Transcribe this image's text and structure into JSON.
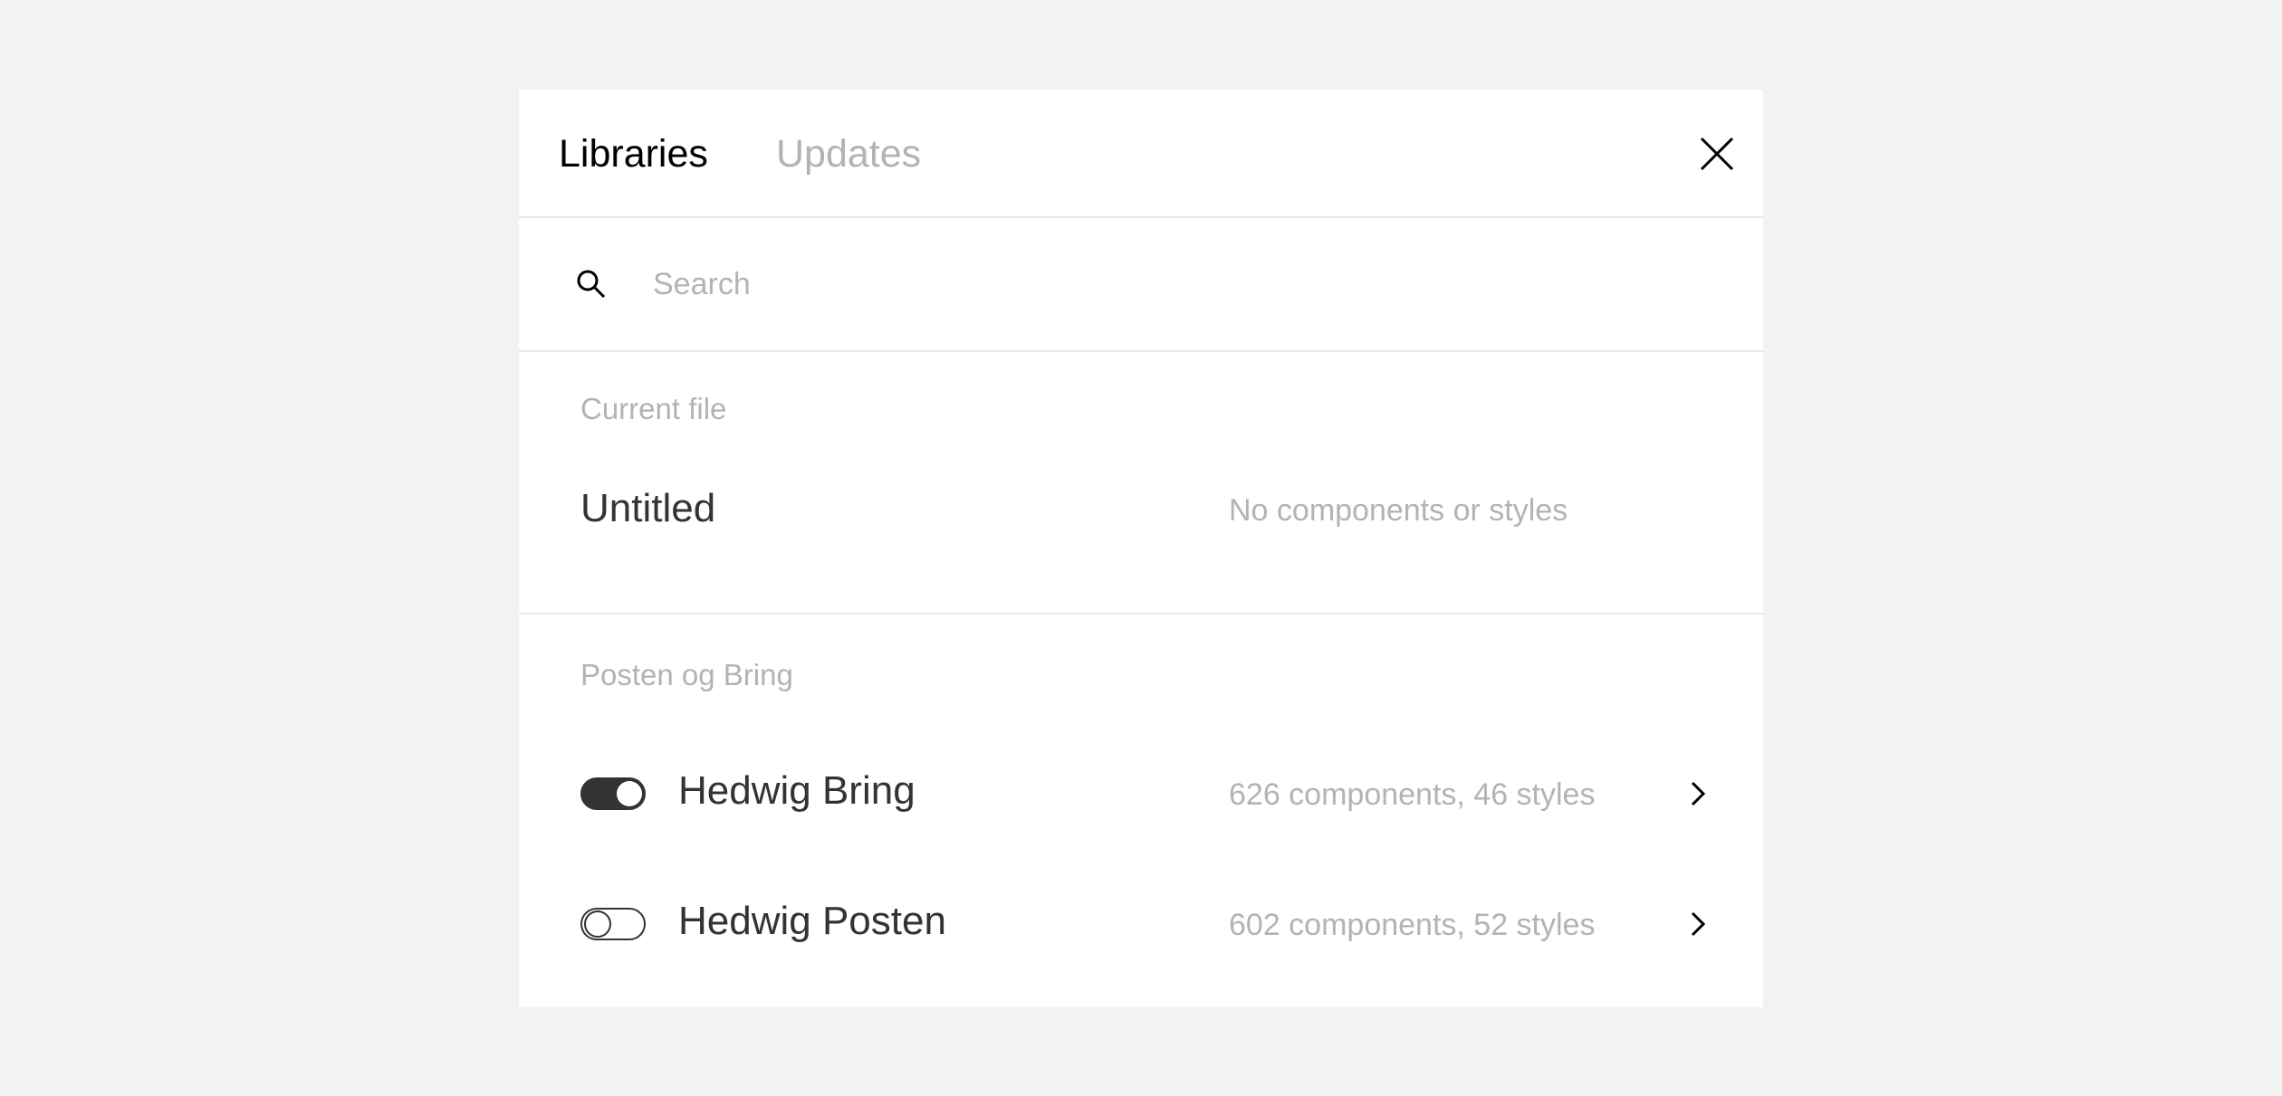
{
  "tabs": [
    {
      "label": "Libraries",
      "active": true
    },
    {
      "label": "Updates",
      "active": false
    }
  ],
  "search": {
    "placeholder": "Search",
    "value": ""
  },
  "current_file": {
    "section_label": "Current file",
    "name": "Untitled",
    "meta": "No components or styles"
  },
  "team": {
    "section_label": "Posten og Bring",
    "libraries": [
      {
        "name": "Hedwig Bring",
        "meta": "626 components, 46 styles",
        "enabled": true
      },
      {
        "name": "Hedwig Posten",
        "meta": "602 components, 52 styles",
        "enabled": false
      }
    ]
  },
  "icons": {
    "close": "close-icon",
    "search": "search-icon",
    "chevron": "chevron-right-icon"
  },
  "colors": {
    "background": "#f2f2f2",
    "panel": "#ffffff",
    "text_primary": "#333333",
    "text_muted": "#b3b3b3",
    "divider": "#e6e6e6"
  }
}
